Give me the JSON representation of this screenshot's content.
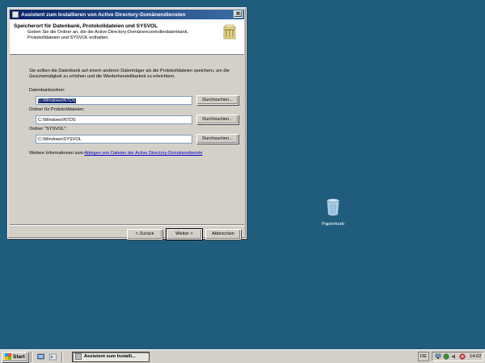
{
  "window": {
    "title": "Assistent zum Installieren von Active Directory-Domänendiensten",
    "close_label": "✕",
    "header_title": "Speicherort für Datenbank, Protokolldateien und SYSVOL",
    "header_desc": "Geben Sie die Ordner an, die die Active Directory-Domänencontrollerdatenbank, Protokolldateien und SYSVOL enthalten.",
    "intro": "Sie sollten die Datenbank auf einem anderen Datenträger als die Protokolldateien speichern, um die Geschwindigkeit zu erhöhen und die Wiederherstellbarkeit zu erleichtern.",
    "db_label": "Datenbankordner:",
    "db_value": "C:\\Windows\\NTDS",
    "log_label": "Ordner für Protokolldateien:",
    "log_value": "C:\\Windows\\NTDS",
    "sysvol_label": "Ordner \"SYSVOL\":",
    "sysvol_value": "C:\\Windows\\SYSVOL",
    "browse_label": "Durchsuchen...",
    "more_info_prefix": "Weitere Informationen zum ",
    "more_info_link": "Ablegen von Dateien der Active Directory-Domänendienste",
    "back_label": "< Zurück",
    "next_label": "Weiter >",
    "cancel_label": "Abbrechen"
  },
  "desktop": {
    "recycle_bin_label": "Papierkorb"
  },
  "taskbar": {
    "start_label": "Start",
    "task_label": "Assistent zum Installi...",
    "language": "DE",
    "clock": "14:02"
  },
  "colors": {
    "desktop": "#205d7c",
    "titlebar_start": "#0a246a",
    "link": "#0000cc"
  }
}
